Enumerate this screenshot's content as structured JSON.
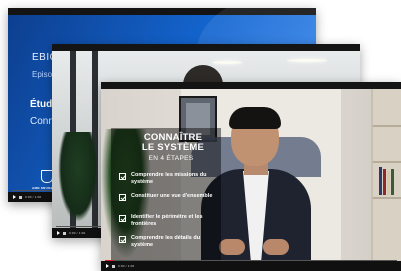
{
  "cards": [
    {
      "slide": {
        "title": "EBIOS",
        "subtitle": "Episod",
        "heading": "Étud",
        "heading2": "Conn",
        "logo_text": "AMN SRUNB"
      },
      "time": "0:00 / 1:00",
      "progress": 0.0
    },
    {
      "time": "0:00 / 1:00",
      "progress": 0.0
    },
    {
      "overlay": {
        "title_line1": "CONNAÎTRE",
        "title_line2": "LE SYSTÈME",
        "subtitle": "EN 4 ÉTAPES",
        "items": [
          "Comprendre les missions du système",
          "Constituer une vue d'ensemble",
          "Identifier le périmètre et les frontières",
          "Comprendre les détails du système"
        ]
      },
      "time": "0:00 / 1:00",
      "progress": 0.03
    }
  ],
  "colors": {
    "progress": "#e31b23",
    "slide_blue": "#1466d1"
  }
}
